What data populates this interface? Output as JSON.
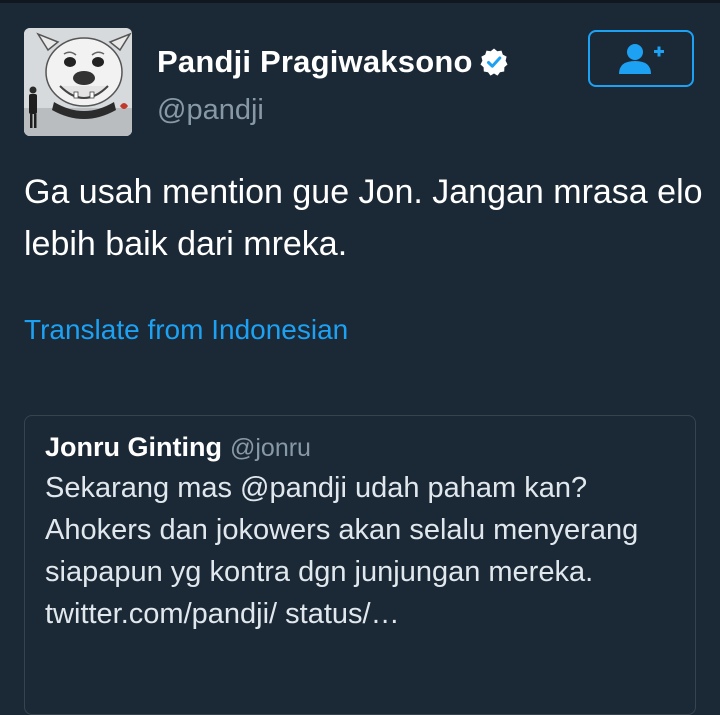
{
  "author": {
    "display_name": "Pandji Pragiwaksono",
    "handle": "@pandji",
    "verified_icon": "verified-badge-icon",
    "avatar_icon": "bulldog-mural-avatar"
  },
  "follow_button": {
    "icon": "add-user-icon"
  },
  "tweet": {
    "text": "Ga usah mention gue Jon. Jangan mrasa elo lebih baik dari mreka.",
    "translate_label": "Translate from Indonesian"
  },
  "quoted_tweet": {
    "display_name": "Jonru Ginting",
    "handle": "@jonru",
    "text": "Sekarang mas @pandji udah paham kan? Ahokers dan jokowers akan selalu menyerang siapapun yg kontra dgn junjungan mereka. twitter.com/pandji/ status/…"
  },
  "colors": {
    "background": "#1b2836",
    "accent": "#1da1f2",
    "secondary_text": "#8899a6",
    "border": "#38444d"
  }
}
